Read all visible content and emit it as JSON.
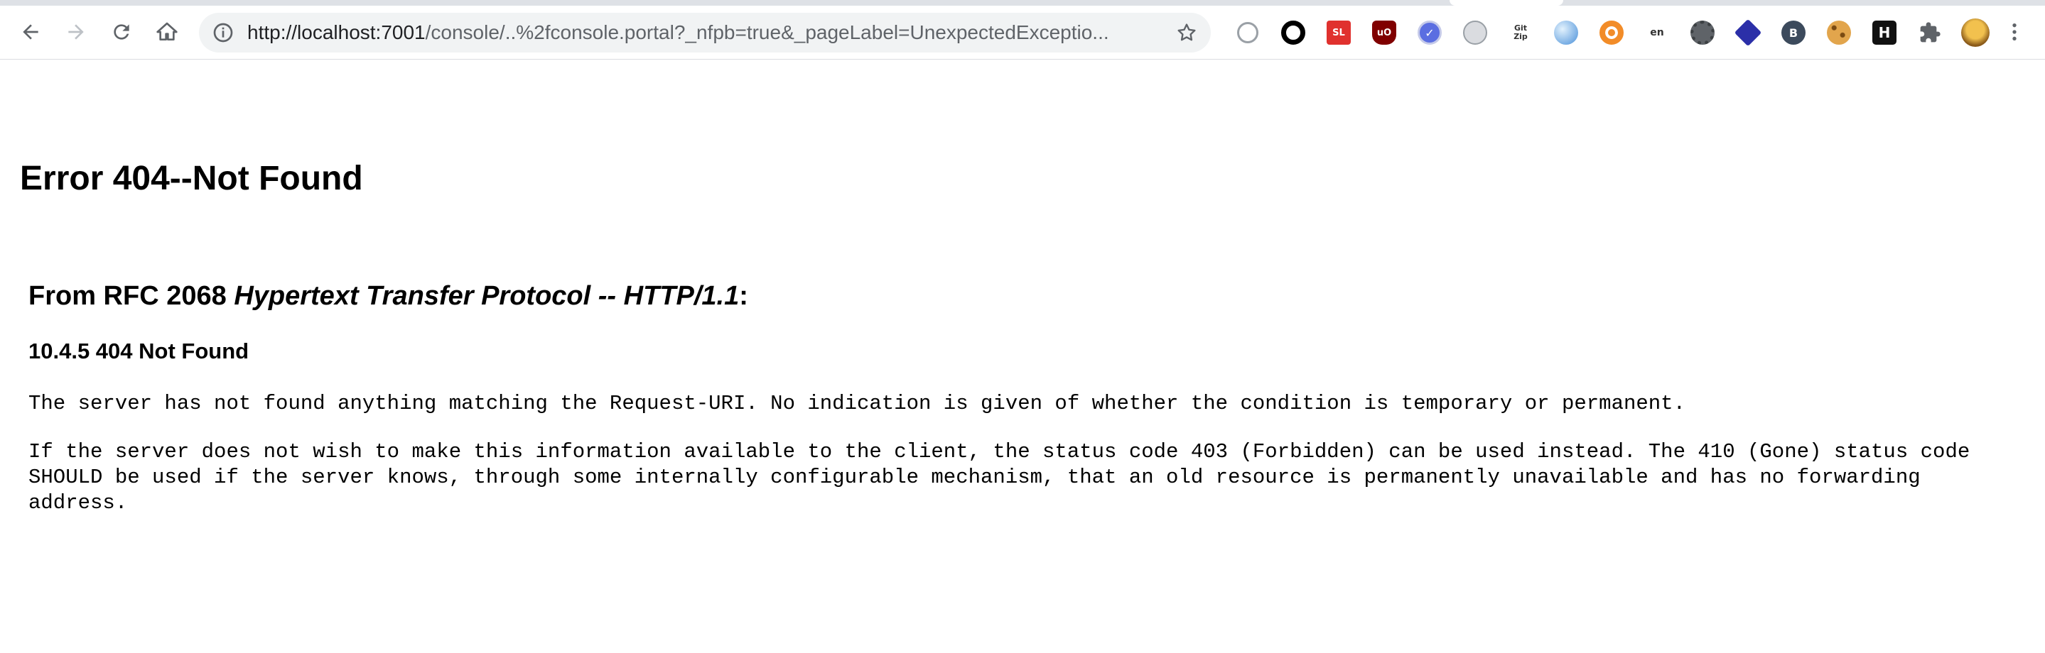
{
  "browser": {
    "url_host": "http://localhost:7001",
    "url_rest": "/console/..%2fconsole.portal?_nfpb=true&_pageLabel=UnexpectedExceptio...",
    "extensions": [
      {
        "icon": "rings-icon",
        "label": ""
      },
      {
        "icon": "black-circle-icon",
        "label": ""
      },
      {
        "icon": "red-square-icon",
        "label": "SL"
      },
      {
        "icon": "ublock-icon",
        "label": "uO"
      },
      {
        "icon": "check-badge-icon",
        "label": "✓"
      },
      {
        "icon": "globe-extension-icon",
        "label": ""
      },
      {
        "icon": "gitzip-icon",
        "label": "Git Zip"
      },
      {
        "icon": "blue-orb-icon",
        "label": ""
      },
      {
        "icon": "orange-ring-icon",
        "label": ""
      },
      {
        "icon": "translate-icon",
        "label": "en"
      },
      {
        "icon": "gear-gray-icon",
        "label": ""
      },
      {
        "icon": "blue-diamond-icon",
        "label": ""
      },
      {
        "icon": "shield-b-icon",
        "label": "B"
      },
      {
        "icon": "cookie-icon",
        "label": ""
      },
      {
        "icon": "h-square-icon",
        "label": "H"
      },
      {
        "icon": "puzzle-icon",
        "label": ""
      },
      {
        "icon": "avatar-icon",
        "label": ""
      }
    ]
  },
  "page": {
    "title": "Error 404--Not Found",
    "rfc_prefix": "From RFC 2068 ",
    "rfc_title": "Hypertext Transfer Protocol -- HTTP/1.1",
    "rfc_suffix": ":",
    "section": "10.4.5 404 Not Found",
    "paragraph1": "The server has not found anything matching the Request-URI. No indication is given of whether the condition is temporary or permanent.",
    "paragraph2": "If the server does not wish to make this information available to the client, the status code 403 (Forbidden) can be used instead. The 410 (Gone) status code SHOULD be used if the server knows, through some internally configurable mechanism, that an old resource is permanently unavailable and has no forwarding address."
  },
  "colors": {
    "chrome_bg": "#ffffff",
    "omnibox_bg": "#f1f3f4",
    "icon_gray": "#5f6368",
    "ublock_red": "#800000",
    "ext_red": "#e0312e"
  }
}
